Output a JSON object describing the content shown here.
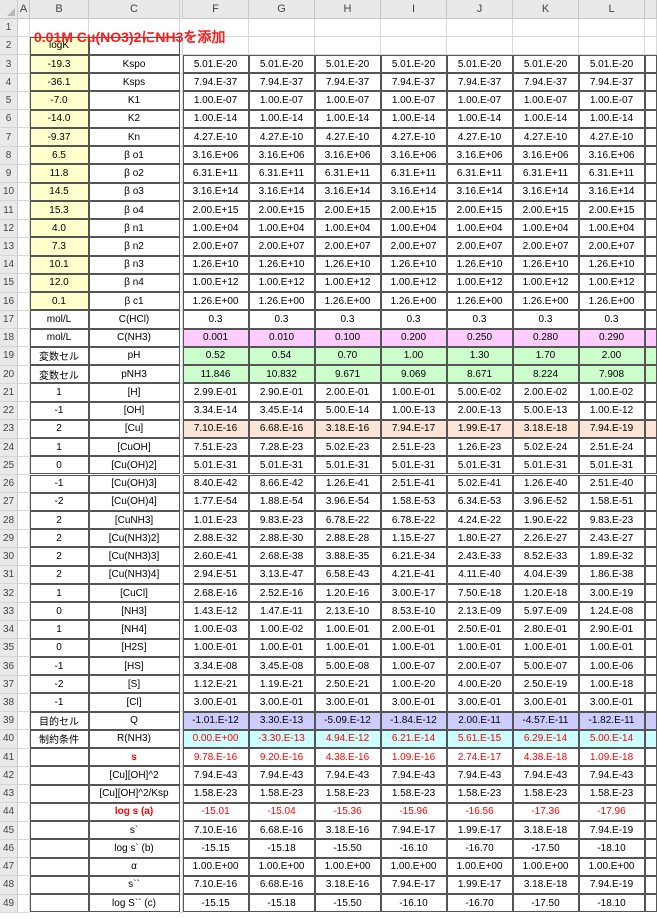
{
  "title": "0.01M Cu(NO3)2にNH3を添加",
  "columns": [
    "A",
    "B",
    "C",
    "D",
    "E",
    "F",
    "G",
    "H",
    "I",
    "J",
    "K",
    "L"
  ],
  "rows": [
    {
      "b": "logK",
      "c": "",
      "vals": [
        "",
        "",
        "",
        "",
        "",
        "",
        ""
      ]
    },
    {
      "b": "-19.3",
      "c": "Kspo",
      "vals": [
        "5.01.E-20",
        "5.01.E-20",
        "5.01.E-20",
        "5.01.E-20",
        "5.01.E-20",
        "5.01.E-20",
        "5.01.E-20"
      ]
    },
    {
      "b": "-36.1",
      "c": "Ksps",
      "vals": [
        "7.94.E-37",
        "7.94.E-37",
        "7.94.E-37",
        "7.94.E-37",
        "7.94.E-37",
        "7.94.E-37",
        "7.94.E-37"
      ]
    },
    {
      "b": "-7.0",
      "c": "K1",
      "vals": [
        "1.00.E-07",
        "1.00.E-07",
        "1.00.E-07",
        "1.00.E-07",
        "1.00.E-07",
        "1.00.E-07",
        "1.00.E-07"
      ]
    },
    {
      "b": "-14.0",
      "c": "K2",
      "vals": [
        "1.00.E-14",
        "1.00.E-14",
        "1.00.E-14",
        "1.00.E-14",
        "1.00.E-14",
        "1.00.E-14",
        "1.00.E-14"
      ]
    },
    {
      "b": "-9.37",
      "c": "Kn",
      "vals": [
        "4.27.E-10",
        "4.27.E-10",
        "4.27.E-10",
        "4.27.E-10",
        "4.27.E-10",
        "4.27.E-10",
        "4.27.E-10"
      ]
    },
    {
      "b": "6.5",
      "c": "β o1",
      "vals": [
        "3.16.E+06",
        "3.16.E+06",
        "3.16.E+06",
        "3.16.E+06",
        "3.16.E+06",
        "3.16.E+06",
        "3.16.E+06"
      ]
    },
    {
      "b": "11.8",
      "c": "β o2",
      "vals": [
        "6.31.E+11",
        "6.31.E+11",
        "6.31.E+11",
        "6.31.E+11",
        "6.31.E+11",
        "6.31.E+11",
        "6.31.E+11"
      ]
    },
    {
      "b": "14.5",
      "c": "β o3",
      "vals": [
        "3.16.E+14",
        "3.16.E+14",
        "3.16.E+14",
        "3.16.E+14",
        "3.16.E+14",
        "3.16.E+14",
        "3.16.E+14"
      ]
    },
    {
      "b": "15.3",
      "c": "β o4",
      "vals": [
        "2.00.E+15",
        "2.00.E+15",
        "2.00.E+15",
        "2.00.E+15",
        "2.00.E+15",
        "2.00.E+15",
        "2.00.E+15"
      ]
    },
    {
      "b": "4.0",
      "c": "β n1",
      "vals": [
        "1.00.E+04",
        "1.00.E+04",
        "1.00.E+04",
        "1.00.E+04",
        "1.00.E+04",
        "1.00.E+04",
        "1.00.E+04"
      ]
    },
    {
      "b": "7.3",
      "c": "β n2",
      "vals": [
        "2.00.E+07",
        "2.00.E+07",
        "2.00.E+07",
        "2.00.E+07",
        "2.00.E+07",
        "2.00.E+07",
        "2.00.E+07"
      ]
    },
    {
      "b": "10.1",
      "c": "β n3",
      "vals": [
        "1.26.E+10",
        "1.26.E+10",
        "1.26.E+10",
        "1.26.E+10",
        "1.26.E+10",
        "1.26.E+10",
        "1.26.E+10"
      ]
    },
    {
      "b": "12.0",
      "c": "β n4",
      "vals": [
        "1.00.E+12",
        "1.00.E+12",
        "1.00.E+12",
        "1.00.E+12",
        "1.00.E+12",
        "1.00.E+12",
        "1.00.E+12"
      ]
    },
    {
      "b": "0.1",
      "c": "β c1",
      "vals": [
        "1.26.E+00",
        "1.26.E+00",
        "1.26.E+00",
        "1.26.E+00",
        "1.26.E+00",
        "1.26.E+00",
        "1.26.E+00"
      ]
    },
    {
      "b": "mol/L",
      "c": "C(HCl)",
      "vals": [
        "0.3",
        "0.3",
        "0.3",
        "0.3",
        "0.3",
        "0.3",
        "0.3"
      ]
    },
    {
      "b": "mol/L",
      "c": "C(NH3)",
      "vals": [
        "0.001",
        "0.010",
        "0.100",
        "0.200",
        "0.250",
        "0.280",
        "0.290"
      ]
    },
    {
      "b": "変数セル",
      "c": "pH",
      "vals": [
        "0.52",
        "0.54",
        "0.70",
        "1.00",
        "1.30",
        "1.70",
        "2.00"
      ]
    },
    {
      "b": "変数セル",
      "c": "pNH3",
      "vals": [
        "11.846",
        "10.832",
        "9.671",
        "9.069",
        "8.671",
        "8.224",
        "7.908"
      ]
    },
    {
      "b": "1",
      "c": "[H]",
      "vals": [
        "2.99.E-01",
        "2.90.E-01",
        "2.00.E-01",
        "1.00.E-01",
        "5.00.E-02",
        "2.00.E-02",
        "1.00.E-02"
      ]
    },
    {
      "b": "-1",
      "c": "[OH]",
      "vals": [
        "3.34.E-14",
        "3.45.E-14",
        "5.00.E-14",
        "1.00.E-13",
        "2.00.E-13",
        "5.00.E-13",
        "1.00.E-12"
      ]
    },
    {
      "b": "2",
      "c": "[Cu]",
      "vals": [
        "7.10.E-16",
        "6.68.E-16",
        "3.18.E-16",
        "7.94.E-17",
        "1.99.E-17",
        "3.18.E-18",
        "7.94.E-19"
      ]
    },
    {
      "b": "1",
      "c": "[CuOH]",
      "vals": [
        "7.51.E-23",
        "7.28.E-23",
        "5.02.E-23",
        "2.51.E-23",
        "1.26.E-23",
        "5.02.E-24",
        "2.51.E-24"
      ]
    },
    {
      "b": "0",
      "c": "[Cu(OH)2]",
      "vals": [
        "5.01.E-31",
        "5.01.E-31",
        "5.01.E-31",
        "5.01.E-31",
        "5.01.E-31",
        "5.01.E-31",
        "5.01.E-31"
      ]
    },
    {
      "b": "-1",
      "c": "[Cu(OH)3]",
      "vals": [
        "8.40.E-42",
        "8.66.E-42",
        "1.26.E-41",
        "2.51.E-41",
        "5.02.E-41",
        "1.26.E-40",
        "2.51.E-40"
      ]
    },
    {
      "b": "-2",
      "c": "[Cu(OH)4]",
      "vals": [
        "1.77.E-54",
        "1.88.E-54",
        "3.96.E-54",
        "1.58.E-53",
        "6.34.E-53",
        "3.96.E-52",
        "1.58.E-51"
      ]
    },
    {
      "b": "2",
      "c": "[CuNH3]",
      "vals": [
        "1.01.E-23",
        "9.83.E-23",
        "6.78.E-22",
        "6.78.E-22",
        "4.24.E-22",
        "1.90.E-22",
        "9.83.E-23"
      ]
    },
    {
      "b": "2",
      "c": "[Cu(NH3)2]",
      "vals": [
        "2.88.E-32",
        "2.88.E-30",
        "2.88.E-28",
        "1.15.E-27",
        "1.80.E-27",
        "2.26.E-27",
        "2.43.E-27"
      ]
    },
    {
      "b": "2",
      "c": "[Cu(NH3)3]",
      "vals": [
        "2.60.E-41",
        "2.68.E-38",
        "3.88.E-35",
        "6.21.E-34",
        "2.43.E-33",
        "8.52.E-33",
        "1.89.E-32"
      ]
    },
    {
      "b": "2",
      "c": "[Cu(NH3)4]",
      "vals": [
        "2.94.E-51",
        "3.13.E-47",
        "6.58.E-43",
        "4.21.E-41",
        "4.11.E-40",
        "4.04.E-39",
        "1.86.E-38"
      ]
    },
    {
      "b": "1",
      "c": "[CuCl]",
      "vals": [
        "2.68.E-16",
        "2.52.E-16",
        "1.20.E-16",
        "3.00.E-17",
        "7.50.E-18",
        "1.20.E-18",
        "3.00.E-19"
      ]
    },
    {
      "b": "0",
      "c": "[NH3]",
      "vals": [
        "1.43.E-12",
        "1.47.E-11",
        "2.13.E-10",
        "8.53.E-10",
        "2.13.E-09",
        "5.97.E-09",
        "1.24.E-08"
      ]
    },
    {
      "b": "1",
      "c": "[NH4]",
      "vals": [
        "1.00.E-03",
        "1.00.E-02",
        "1.00.E-01",
        "2.00.E-01",
        "2.50.E-01",
        "2.80.E-01",
        "2.90.E-01"
      ]
    },
    {
      "b": "0",
      "c": "[H2S]",
      "vals": [
        "1.00.E-01",
        "1.00.E-01",
        "1.00.E-01",
        "1.00.E-01",
        "1.00.E-01",
        "1.00.E-01",
        "1.00.E-01"
      ]
    },
    {
      "b": "-1",
      "c": "[HS]",
      "vals": [
        "3.34.E-08",
        "3.45.E-08",
        "5.00.E-08",
        "1.00.E-07",
        "2.00.E-07",
        "5.00.E-07",
        "1.00.E-06"
      ]
    },
    {
      "b": "-2",
      "c": "[S]",
      "vals": [
        "1.12.E-21",
        "1.19.E-21",
        "2.50.E-21",
        "1.00.E-20",
        "4.00.E-20",
        "2.50.E-19",
        "1.00.E-18"
      ]
    },
    {
      "b": "-1",
      "c": "[Cl]",
      "vals": [
        "3.00.E-01",
        "3.00.E-01",
        "3.00.E-01",
        "3.00.E-01",
        "3.00.E-01",
        "3.00.E-01",
        "3.00.E-01"
      ]
    },
    {
      "b": "目的セル",
      "c": "Q",
      "vals": [
        "-1.01.E-12",
        "3.30.E-13",
        "-5.09.E-12",
        "-1.84.E-12",
        "2.00.E-11",
        "-4.57.E-11",
        "-1.82.E-11"
      ]
    },
    {
      "b": "制約条件",
      "c": "R(NH3)",
      "vals": [
        "0.00.E+00",
        "-3.30.E-13",
        "4.94.E-12",
        "6.21.E-14",
        "5.61.E-15",
        "6.29.E-14",
        "5.00.E-14"
      ]
    },
    {
      "b": "",
      "c": "s",
      "vals": [
        "9.78.E-16",
        "9.20.E-16",
        "4.38.E-16",
        "1.09.E-16",
        "2.74.E-17",
        "4.38.E-18",
        "1.09.E-18"
      ]
    },
    {
      "b": "",
      "c": "[Cu][OH]^2",
      "vals": [
        "7.94.E-43",
        "7.94.E-43",
        "7.94.E-43",
        "7.94.E-43",
        "7.94.E-43",
        "7.94.E-43",
        "7.94.E-43"
      ]
    },
    {
      "b": "",
      "c": "[Cu][OH]^2/Ksp",
      "vals": [
        "1.58.E-23",
        "1.58.E-23",
        "1.58.E-23",
        "1.58.E-23",
        "1.58.E-23",
        "1.58.E-23",
        "1.58.E-23"
      ]
    },
    {
      "b": "",
      "c": "log s (a)",
      "vals": [
        "-15.01",
        "-15.04",
        "-15.36",
        "-15.96",
        "-16.56",
        "-17.36",
        "-17.96"
      ]
    },
    {
      "b": "",
      "c": "s`",
      "vals": [
        "7.10.E-16",
        "6.68.E-16",
        "3.18.E-16",
        "7.94.E-17",
        "1.99.E-17",
        "3.18.E-18",
        "7.94.E-19"
      ]
    },
    {
      "b": "",
      "c": "log s` (b)",
      "vals": [
        "-15.15",
        "-15.18",
        "-15.50",
        "-16.10",
        "-16.70",
        "-17.50",
        "-18.10"
      ]
    },
    {
      "b": "",
      "c": "α",
      "vals": [
        "1.00.E+00",
        "1.00.E+00",
        "1.00.E+00",
        "1.00.E+00",
        "1.00.E+00",
        "1.00.E+00",
        "1.00.E+00"
      ]
    },
    {
      "b": "",
      "c": "s``",
      "vals": [
        "7.10.E-16",
        "6.68.E-16",
        "3.18.E-16",
        "7.94.E-17",
        "1.99.E-17",
        "3.18.E-18",
        "7.94.E-19"
      ]
    },
    {
      "b": "",
      "c": "log S`` (c)",
      "vals": [
        "-15.15",
        "-15.18",
        "-15.50",
        "-16.10",
        "-16.70",
        "-17.50",
        "-18.10"
      ]
    }
  ],
  "styles": {
    "yellow": "#ffffcc",
    "pink": "#ffccff",
    "green": "#ccffcc",
    "peach": "#fce4d6",
    "lavender": "#ccccff",
    "cyan": "#ccffff",
    "red_text": "#ff0000"
  }
}
